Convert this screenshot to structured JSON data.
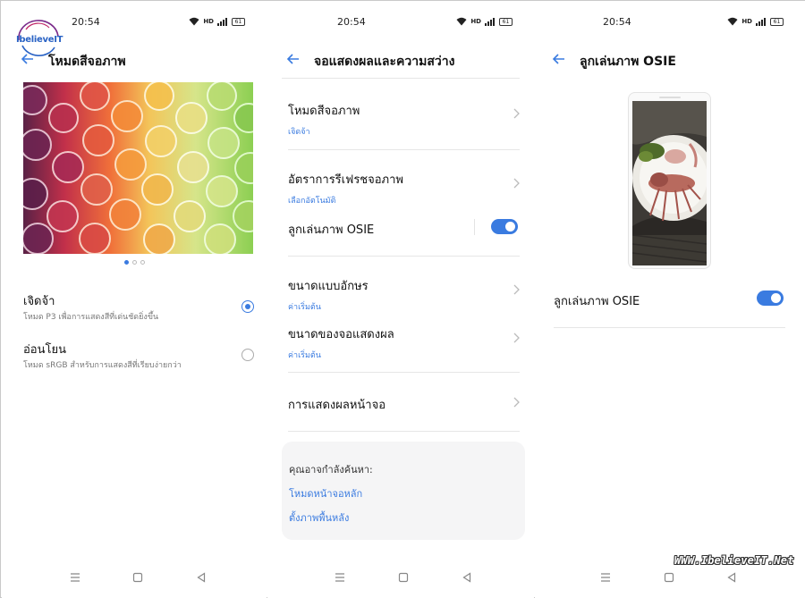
{
  "watermark": {
    "logo_text": "IbelieveIT",
    "site": "WWW.IbelieveIT.Net"
  },
  "colors": {
    "accent": "#3a7be0",
    "divider": "#e6e6e6",
    "card_bg": "#f5f5f6"
  },
  "screens": [
    {
      "status": {
        "time": "20:54",
        "battery": "61"
      },
      "title": "โหมดสีจอภาพ",
      "pager": {
        "count": 3,
        "active": 1
      },
      "options": [
        {
          "title": "เจิดจ้า",
          "subtitle": "โหมด P3 เพื่อการแสดงสีที่เด่นชัดยิ่งขึ้น",
          "selected": true
        },
        {
          "title": "อ่อนโยน",
          "subtitle": "โหมด sRGB สำหรับการแสดงสีที่เรียบง่ายกว่า",
          "selected": false
        }
      ]
    },
    {
      "status": {
        "time": "20:54",
        "battery": "61"
      },
      "title": "จอแสดงผลและความสว่าง",
      "rows": [
        {
          "title": "โหมดสีจอภาพ",
          "subtitle": "เจิดจ้า"
        },
        {
          "title": "อัตราการรีเฟรชจอภาพ",
          "subtitle": "เลือกอัตโนมัติ"
        },
        {
          "title": "ลูกเล่นภาพ OSIE",
          "toggle": true
        },
        {
          "title": "ขนาดแบบอักษร",
          "subtitle": "ค่าเริ่มต้น"
        },
        {
          "title": "ขนาดของจอแสดงผล",
          "subtitle": "ค่าเริ่มต้น"
        },
        {
          "title": "การแสดงผลหน้าจอ"
        }
      ],
      "suggestions": {
        "heading": "คุณอาจกำลังค้นหา:",
        "links": [
          "โหมดหน้าจอหลัก",
          "ตั้งภาพพื้นหลัง"
        ]
      }
    },
    {
      "status": {
        "time": "20:54",
        "battery": "61"
      },
      "title": "ลูกเล่นภาพ OSIE",
      "toggle_row": {
        "title": "ลูกเล่นภาพ OSIE",
        "on": true
      }
    }
  ],
  "icons": {
    "back": "arrow-left-icon",
    "chevron": "chevron-right-icon",
    "nav": [
      "menu-icon",
      "home-square-icon",
      "back-triangle-icon"
    ]
  }
}
